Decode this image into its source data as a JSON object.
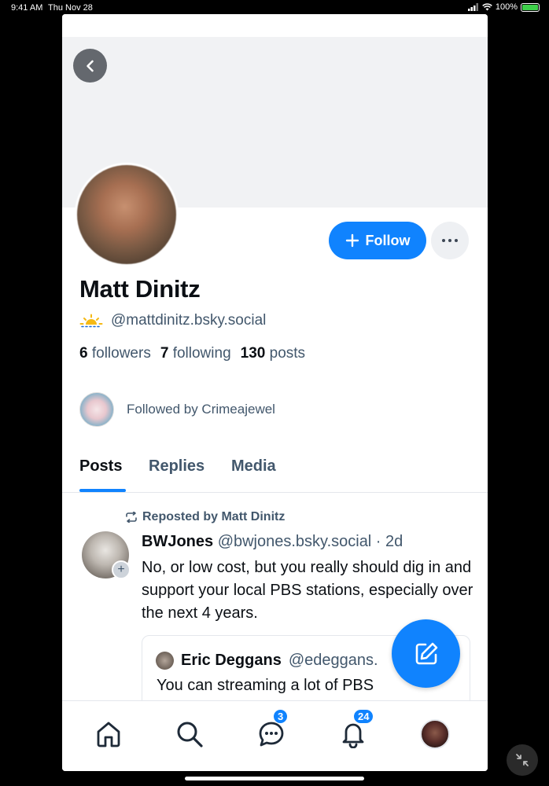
{
  "status_bar": {
    "time": "9:41 AM",
    "date": "Thu Nov 28",
    "battery": "100%",
    "battery_level": 1.0
  },
  "profile": {
    "display_name": "Matt Dinitz",
    "handle": "@mattdinitz.bsky.social",
    "handle_emoji": "🌅",
    "followers_count": "6",
    "followers_label": "followers",
    "following_count": "7",
    "following_label": "following",
    "posts_count": "130",
    "posts_label": "posts",
    "followed_by": "Followed by Crimeajewel",
    "follow_button": "Follow"
  },
  "tabs": [
    {
      "label": "Posts",
      "active": true
    },
    {
      "label": "Replies",
      "active": false
    },
    {
      "label": "Media",
      "active": false
    }
  ],
  "feed": {
    "repost_label": "Reposted by Matt Dinitz",
    "post": {
      "author_name": "BWJones",
      "author_handle": "@bwjones.bsky.social · 2d",
      "text": "No, or low cost, but you really should dig in and support your local PBS stations, especially over the next 4 years.",
      "quote": {
        "author_name": "Eric Deggans",
        "author_handle": "@edeggans.",
        "text": "You can streaming a lot of PBS"
      }
    }
  },
  "bottom_nav": {
    "items": [
      "home",
      "search",
      "chat",
      "notifications",
      "profile"
    ],
    "chat_badge": "3",
    "notifications_badge": "24"
  },
  "colors": {
    "accent": "#1083fe",
    "text_primary": "#0b0f14",
    "text_secondary": "#42576c"
  }
}
